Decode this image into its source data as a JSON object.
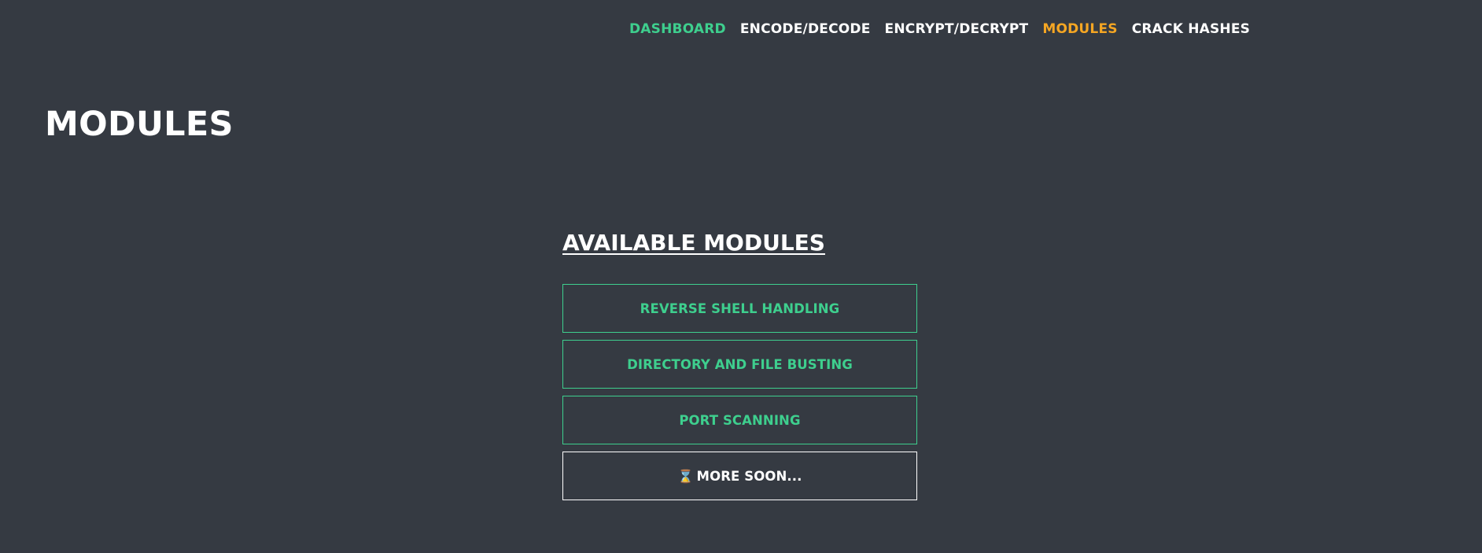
{
  "nav": {
    "items": [
      {
        "label": "DASHBOARD",
        "color": "#3ecf8e"
      },
      {
        "label": "ENCODE/DECODE",
        "color": "#ffffff"
      },
      {
        "label": "ENCRYPT/DECRYPT",
        "color": "#ffffff"
      },
      {
        "label": "MODULES",
        "color": "#f5a623"
      },
      {
        "label": "CRACK HASHES",
        "color": "#ffffff"
      }
    ]
  },
  "page": {
    "title": "MODULES"
  },
  "modules": {
    "heading": "AVAILABLE MODULES",
    "items": [
      {
        "label": "REVERSE SHELL HANDLING"
      },
      {
        "label": "DIRECTORY AND FILE BUSTING"
      },
      {
        "label": "PORT SCANNING"
      }
    ],
    "more": {
      "icon": "hourglass-icon",
      "glyph": "⌛",
      "label": "MORE SOON..."
    }
  },
  "colors": {
    "background": "#353a42",
    "accent_green": "#3ecf8e",
    "accent_orange": "#f5a623",
    "text": "#ffffff"
  }
}
